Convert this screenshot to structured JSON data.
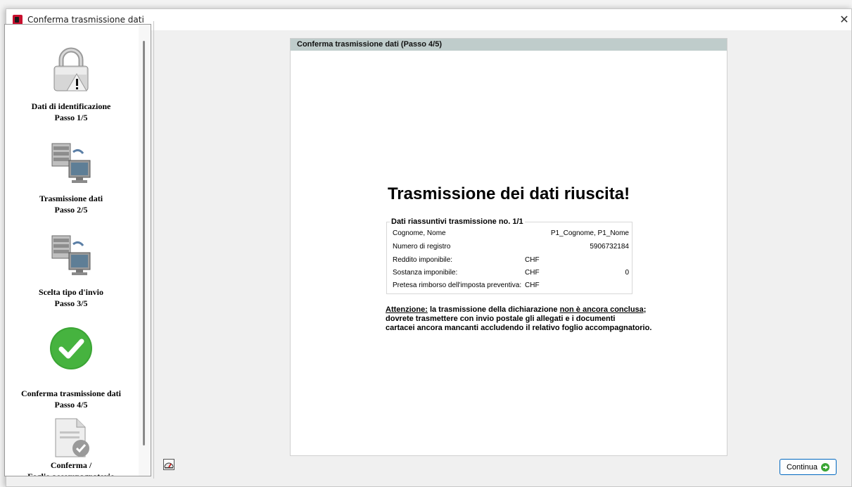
{
  "window": {
    "title": "Conferma trasmissione dati",
    "close_glyph": "✕"
  },
  "sidebar": {
    "steps": [
      {
        "label_line1": "Dati di identificazione",
        "label_line2": "Passo 1/5",
        "icon": "padlock-warning-icon"
      },
      {
        "label_line1": "Trasmissione dati",
        "label_line2": "Passo 2/5",
        "icon": "server-transfer-icon"
      },
      {
        "label_line1": "Scelta tipo d'invio",
        "label_line2": "Passo 3/5",
        "icon": "server-transfer-icon"
      },
      {
        "label_line1": "Conferma trasmissione dati",
        "label_line2": "Passo 4/5",
        "icon": "green-check-icon"
      },
      {
        "label_line1": "Conferma /",
        "label_line2": "Foglio accompagnatorio",
        "icon": "document-check-icon"
      }
    ]
  },
  "panel": {
    "header": "Conferma trasmissione dati (Passo 4/5)",
    "success_title": "Trasmissione dei dati riuscita!",
    "summary": {
      "legend": "Dati riassuntivi trasmissione no. 1/1",
      "rows": [
        {
          "label": "Cognome, Nome",
          "currency": "",
          "value": "P1_Cognome, P1_Nome"
        },
        {
          "label": "Numero di registro",
          "currency": "",
          "value": "5906732184"
        },
        {
          "label": "Reddito imponibile:",
          "currency": "CHF",
          "value": ""
        },
        {
          "label": "Sostanza imponibile:",
          "currency": "CHF",
          "value": "0"
        },
        {
          "label": "Pretesa rimborso dell'imposta preventiva:",
          "currency": "CHF",
          "value": ""
        }
      ]
    },
    "notice": {
      "attention": "Attenzione:",
      "part1": " la trasmissione della dichiarazione ",
      "not_concluded": "non è ancora conclusa",
      "part2": ";",
      "line2": "dovrete trasmettere con invio postale gli allegati e i documenti",
      "line3": "cartacei ancora mancanti accludendo il relativo foglio accompagnatorio."
    }
  },
  "footer": {
    "continue_label": "Continua"
  },
  "colors": {
    "panel_header_bg": "#bfcccb",
    "accent_border": "#0067c0",
    "success_green": "#3ba535",
    "app_icon_red": "#c8102e"
  }
}
